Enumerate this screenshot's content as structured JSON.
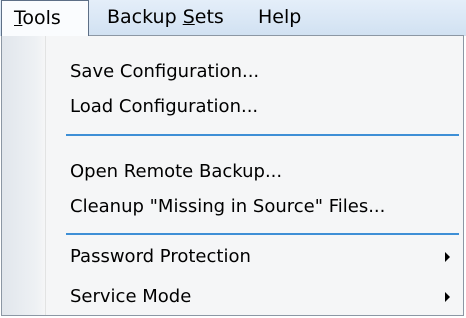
{
  "menubar": {
    "tools_label": "Tools",
    "tools_mnemonic": "T",
    "tools_rest": "ools",
    "backup_sets_pre": "Backup ",
    "backup_sets_mnemonic": "S",
    "backup_sets_rest": "ets",
    "help_label": "Help"
  },
  "tools_menu": {
    "items": [
      {
        "label": "Save Configuration..."
      },
      {
        "label": "Load Configuration..."
      },
      {
        "label": "Open Remote Backup..."
      },
      {
        "label": "Cleanup \"Missing in Source\" Files..."
      },
      {
        "label": "Password Protection",
        "submenu": true
      },
      {
        "label": "Service Mode",
        "submenu": true
      }
    ]
  },
  "colors": {
    "separator": "#3e8fd6",
    "menubar_bg": "#dbe8f6",
    "menu_bg": "#f5f6f7"
  }
}
